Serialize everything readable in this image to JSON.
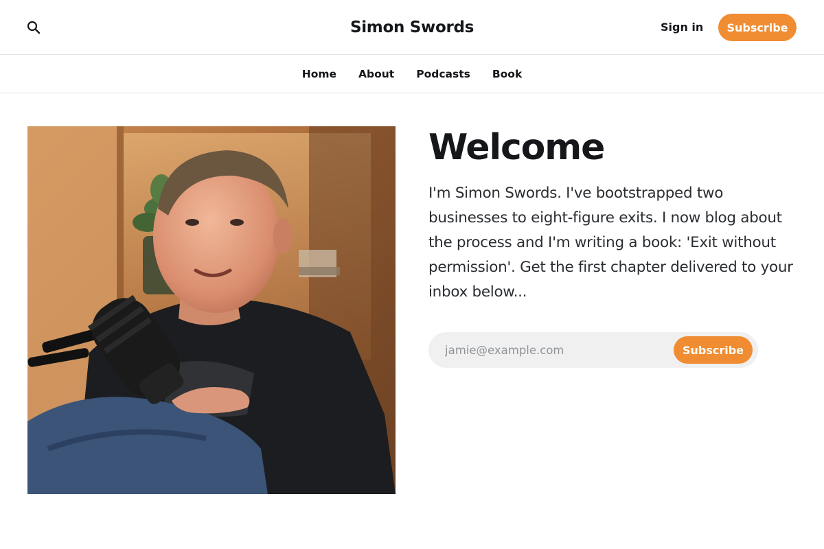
{
  "header": {
    "site_title": "Simon Swords",
    "search_icon": "search-icon",
    "signin_label": "Sign in",
    "subscribe_label": "Subscribe"
  },
  "nav": {
    "items": [
      {
        "label": "Home"
      },
      {
        "label": "About"
      },
      {
        "label": "Podcasts"
      },
      {
        "label": "Book"
      }
    ]
  },
  "hero": {
    "heading": "Welcome",
    "intro": "I'm Simon Swords. I've bootstrapped two businesses to eight-figure exits. I now blog about the process and I'm writing a book: 'Exit without permission'. Get the first chapter delivered to your inbox below...",
    "email_placeholder": "jamie@example.com",
    "subscribe_label": "Subscribe"
  },
  "colors": {
    "accent": "#f08c32",
    "text": "#15171a",
    "input_bg": "#f0f0f0"
  }
}
